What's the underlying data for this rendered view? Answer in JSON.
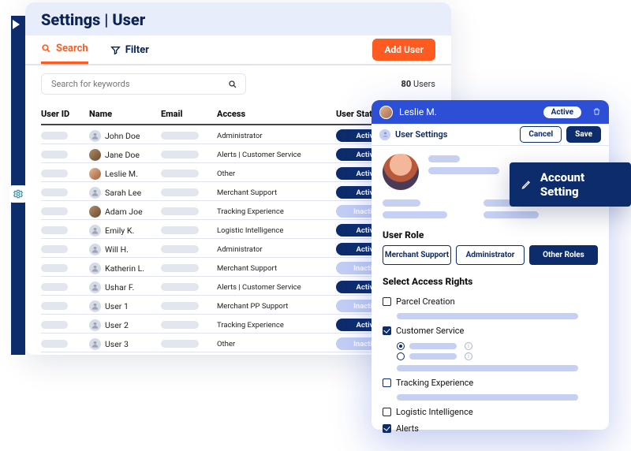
{
  "page": {
    "title": "Settings | User"
  },
  "tabs": {
    "search": "Search",
    "filter": "Filter"
  },
  "actions": {
    "add_user": "Add User"
  },
  "search": {
    "placeholder": "Search for keywords"
  },
  "user_count": {
    "value": "80",
    "suffix": "Users"
  },
  "table": {
    "headers": {
      "id": "User ID",
      "name": "Name",
      "email": "Email",
      "access": "Access",
      "status": "User Status"
    },
    "rows": [
      {
        "name": "John Doe",
        "avatar": "placeholder",
        "access": "Administrator",
        "status": "Active"
      },
      {
        "name": "Jane Doe",
        "avatar": "img1",
        "access": "Alerts | Customer Service",
        "status": "Active"
      },
      {
        "name": "Leslie M.",
        "avatar": "img2",
        "access": "Other",
        "status": "Active"
      },
      {
        "name": "Sarah Lee",
        "avatar": "placeholder",
        "access": "Merchant Support",
        "status": "Active"
      },
      {
        "name": "Adam Joe",
        "avatar": "img1",
        "access": "Tracking Experience",
        "status": "Inactive"
      },
      {
        "name": "Emily K.",
        "avatar": "placeholder",
        "access": "Logistic Intelligence",
        "status": "Active"
      },
      {
        "name": "Will H.",
        "avatar": "placeholder",
        "access": "Administrator",
        "status": "Active"
      },
      {
        "name": "Katherin L.",
        "avatar": "placeholder",
        "access": "Merchant Support",
        "status": "Inactive"
      },
      {
        "name": "Ushar F.",
        "avatar": "placeholder",
        "access": "Alerts | Customer Service",
        "status": "Active"
      },
      {
        "name": "User 1",
        "avatar": "placeholder",
        "access": "Merchant PP Support",
        "status": "Inactive"
      },
      {
        "name": "User 2",
        "avatar": "placeholder",
        "access": "Tracking Experience",
        "status": "Active"
      },
      {
        "name": "User 3",
        "avatar": "placeholder",
        "access": "Other",
        "status": "Inactive"
      }
    ]
  },
  "panel": {
    "name": "Leslie M.",
    "status": "Active",
    "subtitle": "User Settings",
    "buttons": {
      "cancel": "Cancel",
      "save": "Save"
    },
    "role_label": "User Role",
    "roles": [
      {
        "label": "Merchant Support",
        "variant": "outline"
      },
      {
        "label": "Administrator",
        "variant": "outline"
      },
      {
        "label": "Other Roles",
        "variant": "solid"
      }
    ],
    "rights_label": "Select Access Rights",
    "rights": [
      {
        "label": "Parcel Creation",
        "checked": false,
        "has_bar": true
      },
      {
        "label": "Customer Service",
        "checked": true,
        "has_radios": true
      },
      {
        "label": "Tracking Experience",
        "checked": false,
        "has_bar": true
      },
      {
        "label": "Logistic Intelligence",
        "checked": false
      },
      {
        "label": "Alerts",
        "checked": true
      }
    ]
  },
  "badge": {
    "label": "Account Setting"
  }
}
